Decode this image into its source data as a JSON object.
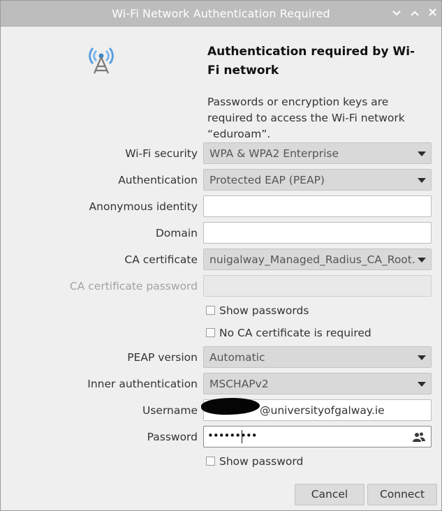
{
  "window": {
    "title": "Wi-Fi Network Authentication Required",
    "controls": {
      "minimize": "⌄",
      "maximize": "⌃",
      "close": "✕"
    }
  },
  "header": {
    "heading": "Authentication required by Wi-Fi network",
    "description": "Passwords or encryption keys are required to access the Wi-Fi network “eduroam”."
  },
  "form": {
    "wifi_security": {
      "label": "Wi-Fi security",
      "value": "WPA & WPA2 Enterprise"
    },
    "authentication": {
      "label": "Authentication",
      "value": "Protected EAP (PEAP)"
    },
    "anonymous_identity": {
      "label": "Anonymous identity",
      "value": ""
    },
    "domain": {
      "label": "Domain",
      "value": ""
    },
    "ca_certificate": {
      "label": "CA certificate",
      "value": "nuigalway_Managed_Radius_CA_Root.crt"
    },
    "ca_certificate_password": {
      "label": "CA certificate password",
      "value": ""
    },
    "show_passwords": {
      "label": "Show passwords",
      "checked": false
    },
    "no_ca_required": {
      "label": "No CA certificate is required",
      "checked": false
    },
    "peap_version": {
      "label": "PEAP version",
      "value": "Automatic"
    },
    "inner_auth": {
      "label": "Inner authentication",
      "value": "MSCHAPv2"
    },
    "username": {
      "label": "Username",
      "value_suffix": "@universityofgalway.ie"
    },
    "password": {
      "label": "Password",
      "value": "•••••••••"
    },
    "show_password": {
      "label": "Show password",
      "checked": false
    }
  },
  "buttons": {
    "cancel": "Cancel",
    "connect": "Connect"
  },
  "icons": {
    "network": "wifi-tower-icon",
    "password_store": "user-people-icon"
  }
}
